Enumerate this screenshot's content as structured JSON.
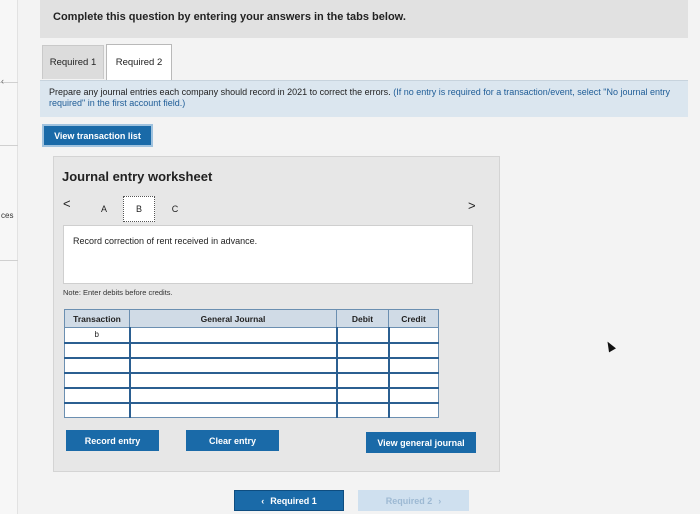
{
  "side": {
    "label": "ces"
  },
  "header": {
    "title": "Complete this question by entering your answers in the tabs below."
  },
  "tabs": [
    {
      "label": "Required 1",
      "active": false
    },
    {
      "label": "Required 2",
      "active": true
    }
  ],
  "instruction": {
    "text": "Prepare any journal entries each company should record in 2021 to correct the errors.",
    "note": "(If no entry is required for a transaction/event, select \"No journal entry required\" in the first account field.)"
  },
  "buttons": {
    "view_transaction_list": "View transaction list",
    "record_entry": "Record entry",
    "clear_entry": "Clear entry",
    "view_general_journal": "View general journal",
    "required_1": "Required 1",
    "required_2": "Required 2"
  },
  "worksheet": {
    "title": "Journal entry worksheet",
    "prev": "<",
    "next": ">",
    "letters": [
      "A",
      "B",
      "C"
    ],
    "selected_letter": "B",
    "description": "Record correction of rent received in advance.",
    "note": "Note: Enter debits before credits."
  },
  "table": {
    "headers": [
      "Transaction",
      "General Journal",
      "Debit",
      "Credit"
    ],
    "transaction": "b",
    "row_count": 6
  },
  "colors": {
    "primary_button": "#1a6aa8",
    "header_bg": "#e1e1e1",
    "instruction_bg": "#dbe6ef"
  }
}
